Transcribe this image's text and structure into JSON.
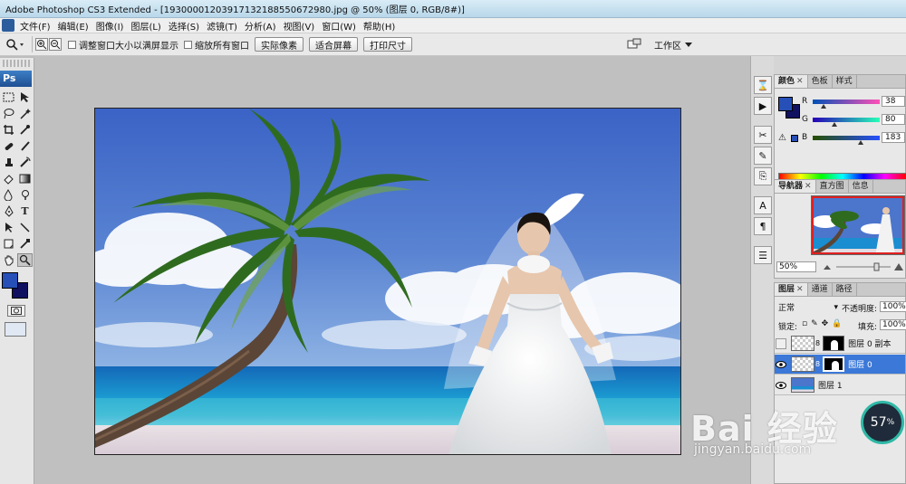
{
  "titlebar": {
    "title": "Adobe Photoshop CS3 Extended - [193000012039171321885506729​80.jpg @ 50% (图层 0, RGB/8#)]"
  },
  "menu": [
    "文件(F)",
    "编辑(E)",
    "图像(I)",
    "图层(L)",
    "选择(S)",
    "滤镜(T)",
    "分析(A)",
    "视图(V)",
    "窗口(W)",
    "帮助(H)"
  ],
  "options": {
    "resize_windows_label": "调整窗口大小以满屏显示",
    "zoom_all_label": "缩放所有窗口",
    "actual_pixels": "实际像素",
    "fit_screen": "适合屏幕",
    "print_size": "打印尺寸",
    "workspace": "工作区"
  },
  "toolbox": {
    "logo": "Ps"
  },
  "colors": {
    "foreground": "#2650b7",
    "background": "#0f1060",
    "selected_layer": "#3b78d8"
  },
  "color_panel": {
    "tabs": [
      "颜色",
      "色板",
      "样式"
    ],
    "channels": [
      {
        "label": "R",
        "value": "38"
      },
      {
        "label": "G",
        "value": "80"
      },
      {
        "label": "B",
        "value": "183"
      }
    ]
  },
  "navigator": {
    "tabs": [
      "导航器",
      "直方图",
      "信息"
    ],
    "zoom": "50%"
  },
  "layers": {
    "tabs": [
      "图层",
      "通道",
      "路径"
    ],
    "blend_mode": "正常",
    "opacity_label": "不透明度:",
    "opacity": "100%",
    "lock_label": "锁定:",
    "fill_label": "填充:",
    "fill": "100%",
    "items": [
      {
        "name": "图层 0 副本",
        "visible": false,
        "selected": false
      },
      {
        "name": "图层 0",
        "visible": true,
        "selected": true
      },
      {
        "name": "图层 1",
        "visible": true,
        "selected": false
      }
    ]
  },
  "watermark": {
    "brand": "Bai 经验",
    "url": "jingyan.baidu.com"
  },
  "badge": {
    "value": "57",
    "unit": "%"
  }
}
